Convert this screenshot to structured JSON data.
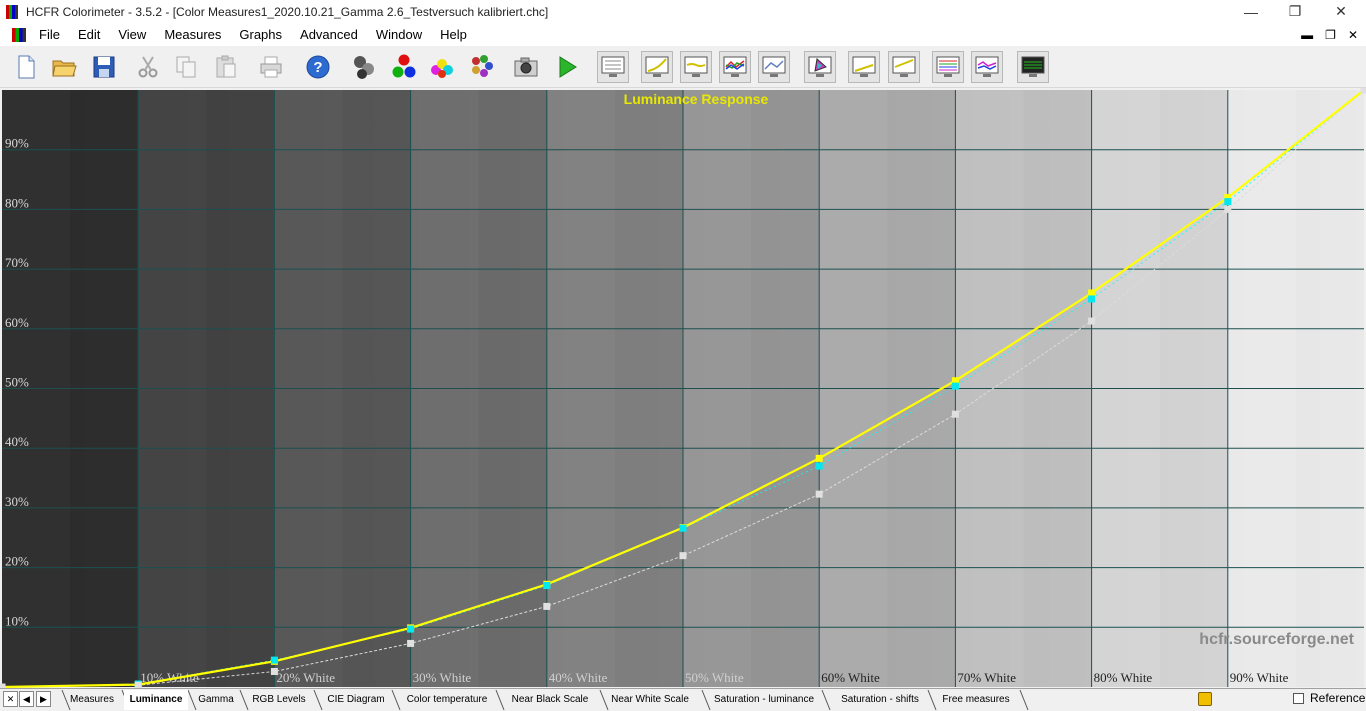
{
  "window": {
    "title": "HCFR Colorimeter - 3.5.2 - [Color Measures1_2020.10.21_Gamma 2.6_Testversuch kalibriert.chc]",
    "minimize": "—",
    "restore": "❐",
    "close": "✕"
  },
  "menu": {
    "items": [
      "File",
      "Edit",
      "View",
      "Measures",
      "Graphs",
      "Advanced",
      "Window",
      "Help"
    ],
    "mdi_minimize": "▬",
    "mdi_restore": "❐",
    "mdi_close": "✕"
  },
  "toolbar": {
    "icons": [
      "new-file-icon",
      "open-folder-icon",
      "save-icon",
      "cut-icon",
      "copy-icon",
      "paste-icon",
      "print-icon",
      "help-icon",
      "sensor-icon",
      "rgb-primaries-icon",
      "secondary-colors-icon",
      "color-palette-icon",
      "camera-icon",
      "play-icon",
      "measures-view-icon",
      "luminance-graph-icon",
      "gamma-graph-icon",
      "rgb-levels-icon",
      "color-temp-graph-icon",
      "cie-diagram-icon",
      "near-black-icon",
      "near-white-icon",
      "saturation-luminance-icon",
      "saturation-shifts-icon",
      "free-measures-icon"
    ]
  },
  "chart_data": {
    "type": "line",
    "title": "Luminance Response",
    "watermark": "hcfr.sourceforge.net",
    "x": [
      0,
      10,
      20,
      30,
      40,
      50,
      60,
      70,
      80,
      90,
      100
    ],
    "categories": [
      "",
      "10% White",
      "20% White",
      "30% White",
      "40% White",
      "50% White",
      "60% White",
      "70% White",
      "80% White",
      "90% White",
      ""
    ],
    "xlim": [
      0,
      100
    ],
    "ylim": [
      0,
      100
    ],
    "yticks": [
      10,
      20,
      30,
      40,
      50,
      60,
      70,
      80,
      90
    ],
    "ytick_labels": [
      "10%",
      "20%",
      "30%",
      "40%",
      "50%",
      "60%",
      "70%",
      "80%",
      "90%"
    ],
    "grid": true,
    "series": [
      {
        "color": "#ffff00",
        "style": "solid",
        "values": [
          0,
          0.4,
          4.3,
          9.9,
          17.2,
          26.7,
          38.3,
          51.3,
          66.0,
          82.0,
          100
        ]
      },
      {
        "color": "#00ffff",
        "style": "markers",
        "values": [
          0,
          0.5,
          4.5,
          9.7,
          17.0,
          26.6,
          37.0,
          50.4,
          65.0,
          81.3,
          100
        ]
      },
      {
        "color": "#dcdcdc",
        "style": "dashed",
        "values": [
          0,
          0.3,
          2.6,
          7.3,
          13.5,
          22.0,
          32.3,
          45.7,
          61.3,
          80.0,
          100
        ]
      }
    ]
  },
  "tabs": {
    "items": [
      "Measures",
      "Luminance",
      "Gamma",
      "RGB Levels",
      "CIE Diagram",
      "Color temperature",
      "Near Black Scale",
      "Near White Scale",
      "Saturation - luminance",
      "Saturation - shifts",
      "Free measures"
    ],
    "active": "Luminance",
    "nav_first": "✕",
    "nav_prev": "◀",
    "nav_next": "▶",
    "reference_label": "Reference"
  }
}
